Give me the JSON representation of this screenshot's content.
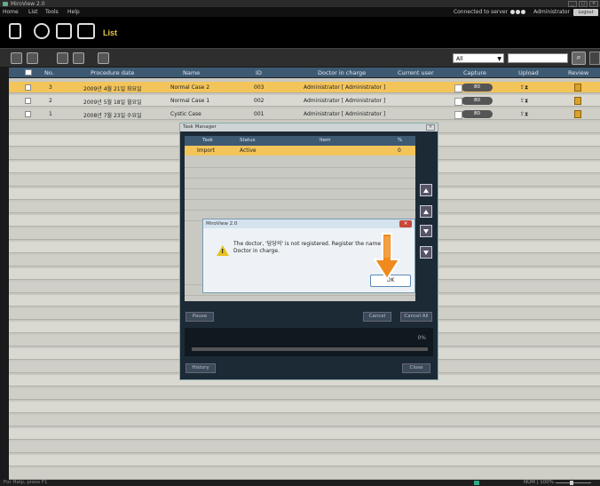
{
  "window": {
    "title": "MiroView 2.0"
  },
  "menu": {
    "items": [
      "Home",
      "List",
      "Tools",
      "Help"
    ],
    "status": "Connected to server",
    "user": "Administrator",
    "logout": "Logout"
  },
  "toolbar": {
    "list_label": "List"
  },
  "filter": {
    "selected": "All"
  },
  "table": {
    "headers": [
      "No.",
      "Procedure date",
      "Name",
      "ID",
      "Doctor in charge",
      "Current user",
      "Capture",
      "Upload",
      "Review"
    ],
    "rows": [
      {
        "no": "3",
        "date": "2009년 4월 21일 화요일",
        "name": "Normal Case 2",
        "id": "003",
        "doctor": "Administrator [ Administrator ]",
        "capture": "80",
        "selected": true
      },
      {
        "no": "2",
        "date": "2009년 5월 18일 월요일",
        "name": "Normal Case 1",
        "id": "002",
        "doctor": "Administrator [ Administrator ]",
        "capture": "80",
        "selected": false
      },
      {
        "no": "1",
        "date": "2008년 7월 23일 수요일",
        "name": "Cystic Case",
        "id": "001",
        "doctor": "Administrator [ Administrator ]",
        "capture": "80",
        "selected": false
      }
    ]
  },
  "task_manager": {
    "title": "Task Manager",
    "headers": [
      "Task",
      "Status",
      "Item",
      "%"
    ],
    "row": {
      "task": "Import",
      "status": "Active",
      "item": "",
      "pct": "0"
    },
    "buttons": {
      "pause": "Pause",
      "cancel": "Cancel",
      "cancel_all": "Cancel All",
      "history": "History",
      "close": "Close"
    },
    "progress_pct": "0%"
  },
  "dialog": {
    "title": "MiroView 2.0",
    "message": "The doctor, '담당의' is not registered. Register the name as Doctor in charge.",
    "ok": "OK"
  },
  "statusbar": {
    "hint": "For Help, press F1",
    "zoom": "NUM | 100%"
  },
  "colors": {
    "selected_row": "#f3c45a",
    "header": "#3e5a73",
    "arrow": "#f08a1c"
  }
}
